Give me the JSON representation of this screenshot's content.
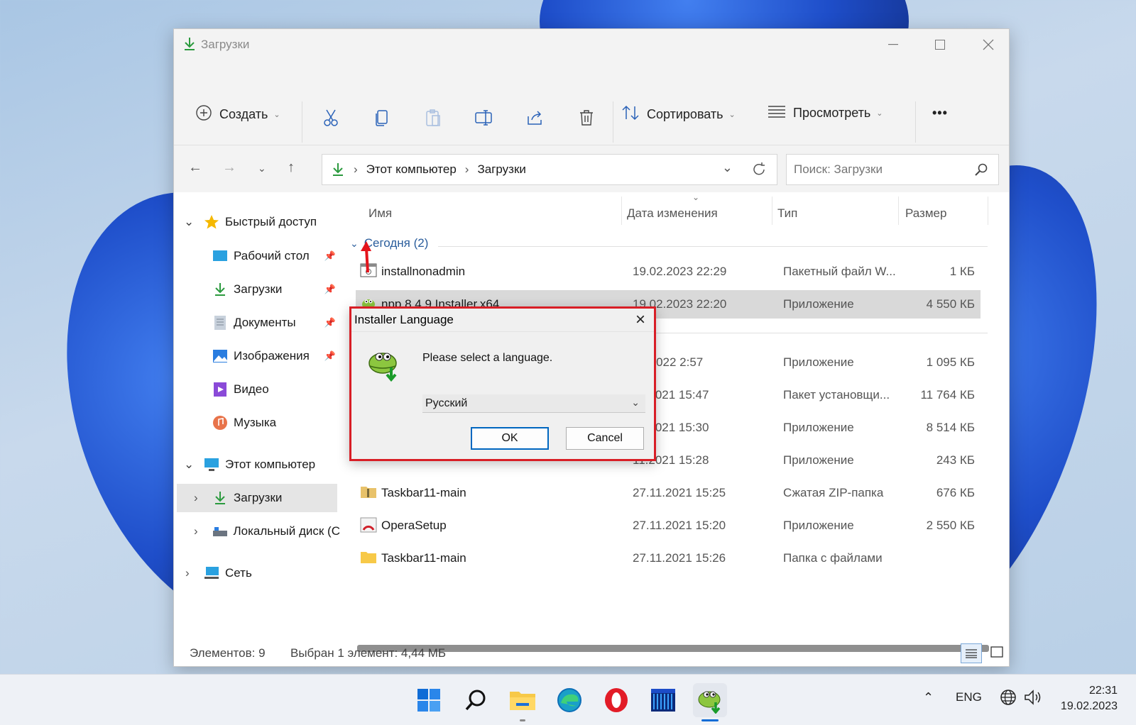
{
  "window": {
    "title": "Загрузки",
    "toolbar": {
      "create_label": "Создать",
      "sort_label": "Сортировать",
      "view_label": "Просмотреть",
      "more_label": "•••"
    },
    "address": {
      "crumbs": [
        "Этот компьютер",
        "Загрузки"
      ]
    },
    "search": {
      "placeholder": "Поиск: Загрузки"
    }
  },
  "sidebar": {
    "quick_access": "Быстрый доступ",
    "items": [
      {
        "label": "Рабочий стол"
      },
      {
        "label": "Загрузки"
      },
      {
        "label": "Документы"
      },
      {
        "label": "Изображения"
      },
      {
        "label": "Видео"
      },
      {
        "label": "Музыка"
      }
    ],
    "this_pc": "Этот компьютер",
    "pc_items": [
      {
        "label": "Загрузки"
      },
      {
        "label": "Локальный диск (С"
      }
    ],
    "network": "Сеть"
  },
  "columns": {
    "name": "Имя",
    "date": "Дата изменения",
    "type": "Тип",
    "size": "Размер"
  },
  "group": {
    "label": "Сегодня (2)"
  },
  "files": [
    {
      "name": "installnonadmin",
      "date": "19.02.2023 22:29",
      "type": "Пакетный файл W...",
      "size": "1 КБ"
    },
    {
      "name": "npp.8.4.9.Installer.x64",
      "date": "19.02.2023 22:20",
      "type": "Приложение",
      "size": "4 550 КБ"
    },
    {
      "name": "",
      "date": "07.2022 2:57",
      "type": "Приложение",
      "size": "1 095 КБ"
    },
    {
      "name": "",
      "date": "11.2021 15:47",
      "type": "Пакет установщи...",
      "size": "11 764 КБ"
    },
    {
      "name": "",
      "date": "11.2021 15:30",
      "type": "Приложение",
      "size": "8 514 КБ"
    },
    {
      "name": "",
      "date": "11.2021 15:28",
      "type": "Приложение",
      "size": "243 КБ"
    },
    {
      "name": "Taskbar11-main",
      "date": "27.11.2021 15:25",
      "type": "Сжатая ZIP-папка",
      "size": "676 КБ"
    },
    {
      "name": "OperaSetup",
      "date": "27.11.2021 15:20",
      "type": "Приложение",
      "size": "2 550 КБ"
    },
    {
      "name": "Taskbar11-main",
      "date": "27.11.2021 15:26",
      "type": "Папка с файлами",
      "size": ""
    }
  ],
  "status": {
    "count": "Элементов: 9",
    "selected": "Выбран 1 элемент: 4,44 МБ"
  },
  "dialog": {
    "title": "Installer Language",
    "message": "Please select a language.",
    "language": "Русский",
    "ok": "OK",
    "cancel": "Cancel",
    "highlight_color": "#d81e26"
  },
  "taskbar": {
    "lang": "ENG",
    "time": "22:31",
    "date": "19.02.2023"
  }
}
